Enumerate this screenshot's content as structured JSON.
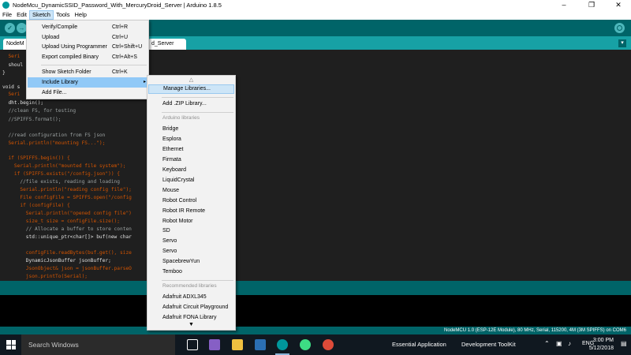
{
  "window": {
    "title": "NodeMcu_DynamicSSID_Password_With_MercuryDroid_Server | Arduino 1.8.5",
    "controls": [
      "–",
      "❐",
      "✕"
    ]
  },
  "menubar": [
    "File",
    "Edit",
    "Sketch",
    "Tools",
    "Help"
  ],
  "toolbar": {
    "buttons": [
      "✓",
      "→"
    ]
  },
  "tabs": {
    "first": "NodeM",
    "second": "d_Server",
    "menu_glyph": "▾"
  },
  "code": [
    "  Seri",
    "  shoul",
    "}",
    "",
    "void s",
    "  Seri",
    "  dht.begin();",
    "  //clean FS, for testing",
    "  //SPIFFS.format();",
    "",
    "  //read configuration from FS json",
    "  Serial.println(\"mounting FS...\");",
    "",
    "  if (SPIFFS.begin()) {",
    "    Serial.println(\"mounted file system\");",
    "    if (SPIFFS.exists(\"/config.json\")) {",
    "      //file exists, reading and loading",
    "      Serial.println(\"reading config file\");",
    "      File configFile = SPIFFS.open(\"/config",
    "      if (configFile) {",
    "        Serial.println(\"opened config file\")",
    "        size_t size = configFile.size();",
    "        // Allocate a buffer to store conten",
    "        std::unique_ptr<char[]> buf(new char",
    "",
    "        configFile.readBytes(buf.get(), size",
    "        DynamicJsonBuffer jsonBuffer;",
    "        JsonObject& json = jsonBuffer.parseO",
    "        json.printTo(Serial);"
  ],
  "sketch_menu": {
    "items": [
      {
        "label": "Verify/Compile",
        "shortcut": "Ctrl+R"
      },
      {
        "label": "Upload",
        "shortcut": "Ctrl+U"
      },
      {
        "label": "Upload Using Programmer",
        "shortcut": "Ctrl+Shift+U"
      },
      {
        "label": "Export compiled Binary",
        "shortcut": "Ctrl+Alt+S"
      },
      {
        "label": "Show Sketch Folder",
        "shortcut": "Ctrl+K"
      },
      {
        "label": "Include Library",
        "shortcut": ""
      },
      {
        "label": "Add File...",
        "shortcut": ""
      }
    ],
    "submenu_arrow": "▸"
  },
  "library_menu": {
    "scroll_up": "△",
    "scroll_down": "▼",
    "manage": "Manage Libraries...",
    "add_zip": "Add .ZIP Library...",
    "arduino_header": "Arduino libraries",
    "arduino_libraries": [
      "Bridge",
      "Esplora",
      "Ethernet",
      "Firmata",
      "Keyboard",
      "LiquidCrystal",
      "Mouse",
      "Robot Control",
      "Robot IR Remote",
      "Robot Motor",
      "SD",
      "Servo",
      "Servo",
      "SpacebrewYun",
      "Temboo"
    ],
    "recommended_header": "Recommended libraries",
    "recommended_libraries": [
      "Adafruit ADXL345",
      "Adafruit Circuit Playground",
      "Adafruit FONA Library"
    ]
  },
  "status": {
    "board": "NodeMCU 1.0 (ESP-12E Module), 80 MHz, Serial, 115200, 4M (3M SPIFFS) on COM6"
  },
  "taskbar": {
    "search_placeholder": "Search Windows",
    "pinned_icons": [
      "task-view-icon",
      "visual-studio-icon",
      "file-explorer-icon",
      "photos-icon",
      "arduino-icon",
      "android-studio-icon",
      "chrome-icon"
    ],
    "running_apps": [
      "Essential Application",
      "Development ToolKit"
    ],
    "tray_language": "ENG",
    "time": "3:00 PM",
    "date": "5/12/2018"
  },
  "colors": {
    "arduino_teal": "#006468",
    "tab_strip": "#17a1a5",
    "editor_bg": "#1f1f1f",
    "menu_highlight": "#91c9f7",
    "taskbar_bg": "#101820"
  }
}
